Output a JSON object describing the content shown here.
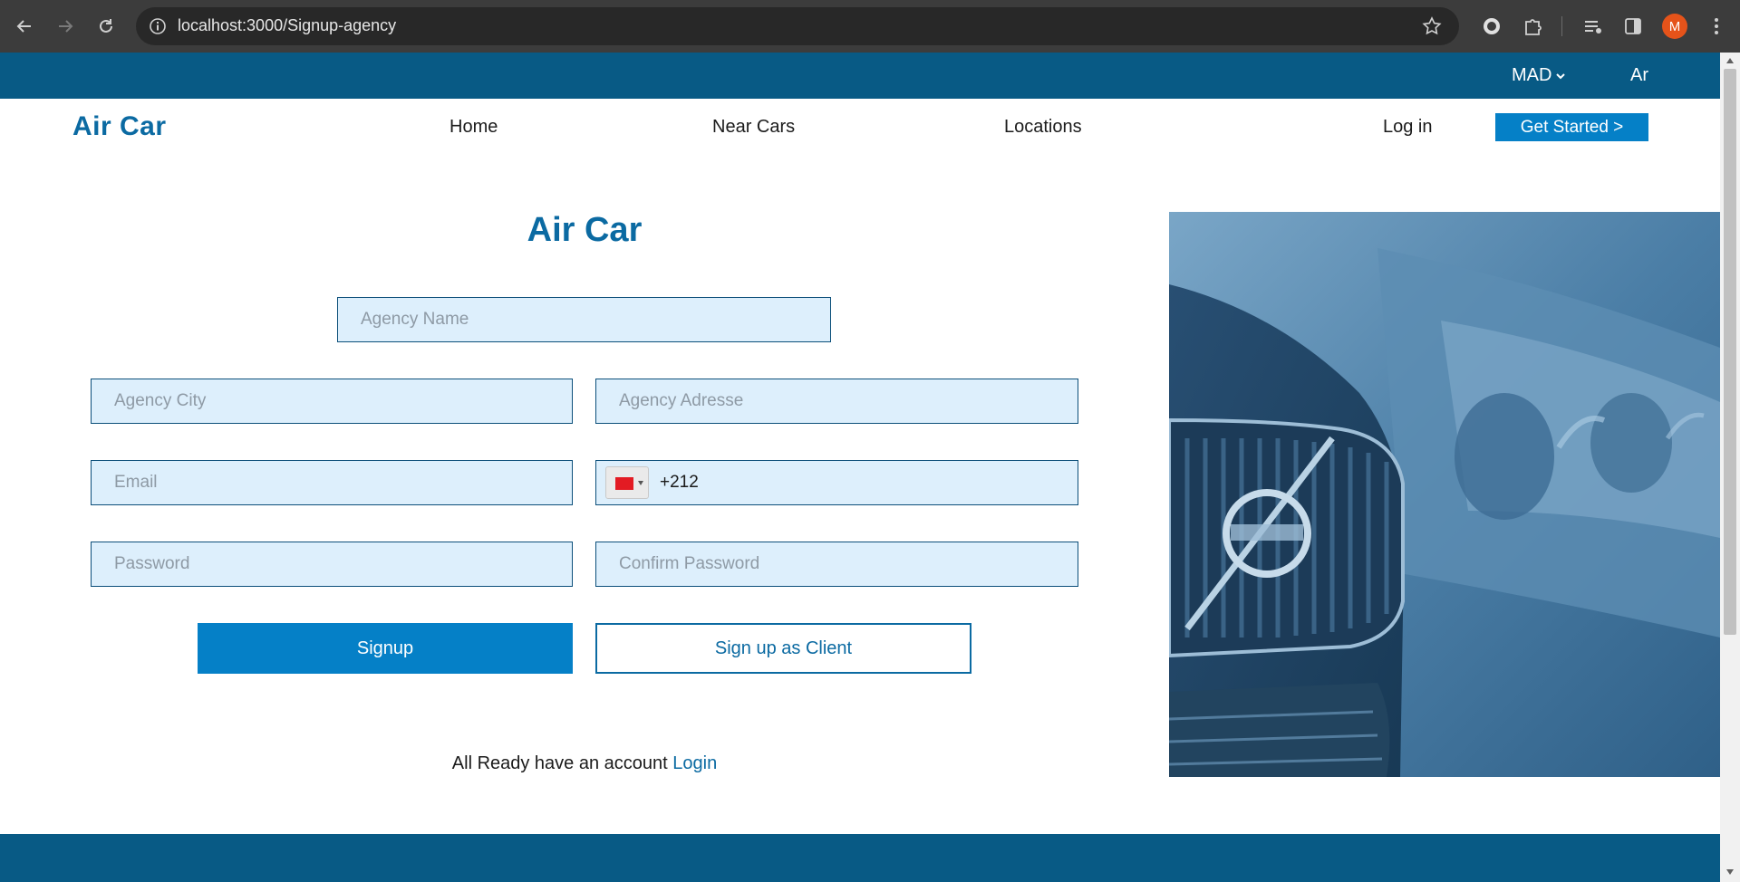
{
  "browser": {
    "url": "localhost:3000/Signup-agency",
    "profile_initial": "M"
  },
  "topbar": {
    "currency": "MAD",
    "language": "Ar"
  },
  "navbar": {
    "brand": "Air Car",
    "links": [
      "Home",
      "Near Cars",
      "Locations"
    ],
    "login": "Log in",
    "get_started": "Get Started >"
  },
  "form": {
    "title": "Air Car",
    "agency_name_placeholder": "Agency Name",
    "agency_city_placeholder": "Agency City",
    "agency_address_placeholder": "Agency Adresse",
    "email_placeholder": "Email",
    "phone_value": "+212",
    "password_placeholder": "Password",
    "confirm_password_placeholder": "Confirm Password",
    "signup_button": "Signup",
    "client_button": "Sign up as Client",
    "account_text": "All Ready have an account",
    "login_link": "Login"
  },
  "colors": {
    "primary": "#085a85",
    "accent": "#0580c7",
    "field_bg": "#ddeffc"
  },
  "icons": {
    "back": "arrow-left-icon",
    "forward": "arrow-right-icon",
    "reload": "reload-icon",
    "site_info": "info-icon",
    "bookmark": "star-icon",
    "currency_dropdown": "chevron-down-icon",
    "phone_flag": "morocco-flag-icon"
  }
}
